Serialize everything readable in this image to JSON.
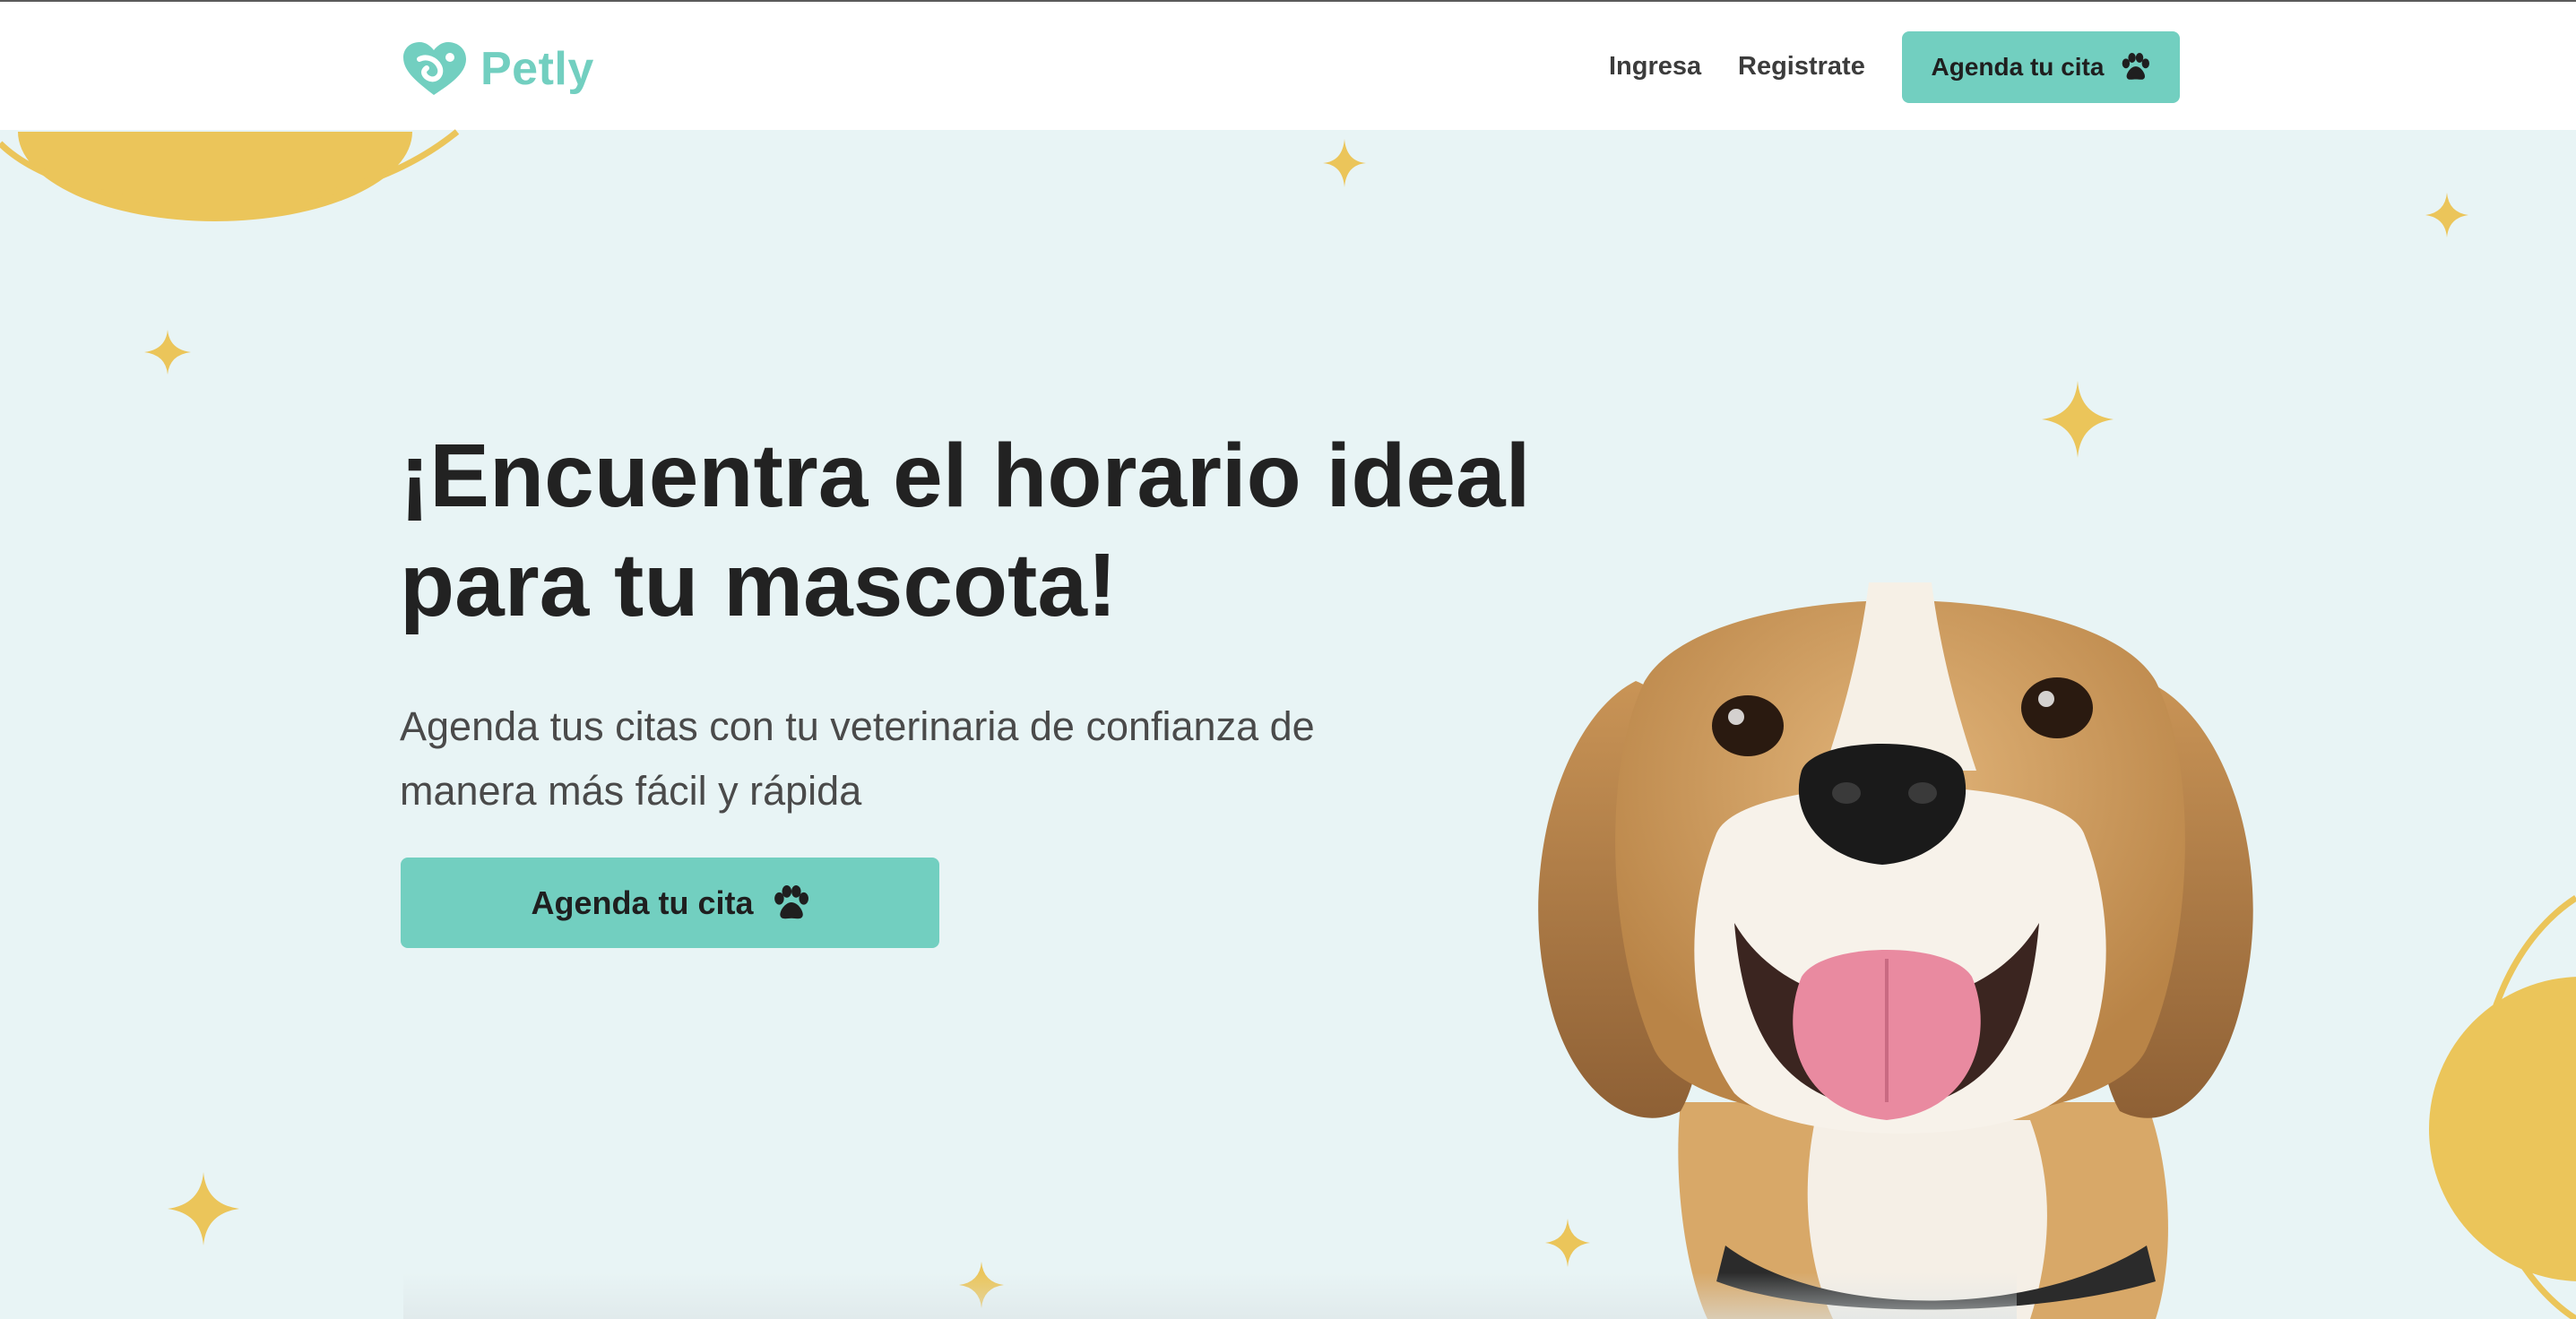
{
  "brand": {
    "name": "Petly",
    "logo_icon": "heart-paw-logo-icon",
    "color": "#72cfc0"
  },
  "nav": {
    "ingresa": "Ingresa",
    "registrate": "Registrate",
    "cta_label": "Agenda tu cita",
    "cta_icon": "paw-icon"
  },
  "hero": {
    "title": "¡Encuentra el horario ideal para tu mascota!",
    "subtitle": "Agenda tus citas con tu veterinaria de confianza de manera más fácil y rápida",
    "cta_label": "Agenda tu cita",
    "cta_icon": "paw-icon",
    "image": "beagle-dog-photo"
  },
  "colors": {
    "accent": "#72cfc0",
    "background": "#e8f4f5",
    "decoration_yellow": "#ebc55a",
    "heading": "#222222"
  }
}
